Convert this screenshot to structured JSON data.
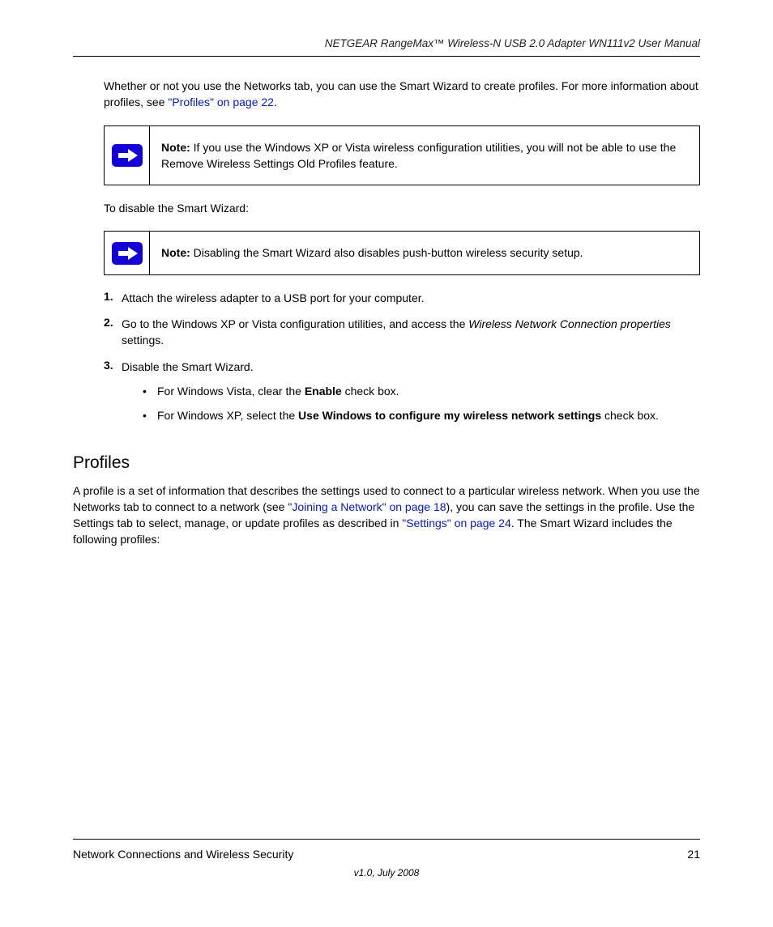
{
  "header": {
    "product": "NETGEAR RangeMax™ Wireless-N USB 2.0 Adapter WN111v2 User Manual"
  },
  "para1_prefix": "Whether or not you use the Networks tab, you can use the Smart Wizard to create profiles.",
  "para1_suffix": " For more information about profiles, see ",
  "para1_link_text": "\"Profiles\" on page 22",
  "para1_end": ".",
  "note1": {
    "label": "Note:",
    "text": " If you use the Windows XP or Vista wireless configuration utilities, you will not be able to use the Remove Wireless Settings Old Profiles feature."
  },
  "para2": "To disable the Smart Wizard:",
  "note2": {
    "label": "Note:",
    "text": " Disabling the Smart Wizard also disables push-button wireless security setup."
  },
  "step1_num": "1.",
  "step1_text": "Attach the wireless adapter to a USB port for your computer.",
  "step2_num": "2.",
  "step2_text_prefix": "Go to the Windows XP or Vista configuration utilities, and access the ",
  "step2_text_em": "Wireless Network Connection properties",
  "step2_text_suffix": " settings.",
  "step3_num": "3.",
  "step3_text": "Disable the Smart Wizard.",
  "sub_a_bullet": "•",
  "sub_a_prefix": "For Windows Vista, clear the ",
  "sub_a_bold": "Enable",
  "sub_a_suffix": " check box.",
  "sub_b_bullet": "•",
  "sub_b_prefix": "For Windows XP, select the ",
  "sub_b_bold": "Use Windows to configure my wireless network settings",
  "sub_b_suffix": " check box.",
  "h2_profiles": "Profiles",
  "profiles_p_prefix": "A profile is a set of information that describes the settings used to connect to a particular wireless network. When you use the Networks tab to connect to a network (see ",
  "profiles_link1": "\"Joining a Network\" on page 18",
  "profiles_p_mid": "), you can save the settings in the profile. Use the Settings tab to select, manage, or update profiles as described in ",
  "profiles_link2": "\"Settings\" on page 24",
  "profiles_p_end": ". The Smart Wizard includes the following profiles:",
  "footer": {
    "section": "Network Connections and Wireless Security",
    "page": "21",
    "version_line": "v1.0, July 2008"
  }
}
